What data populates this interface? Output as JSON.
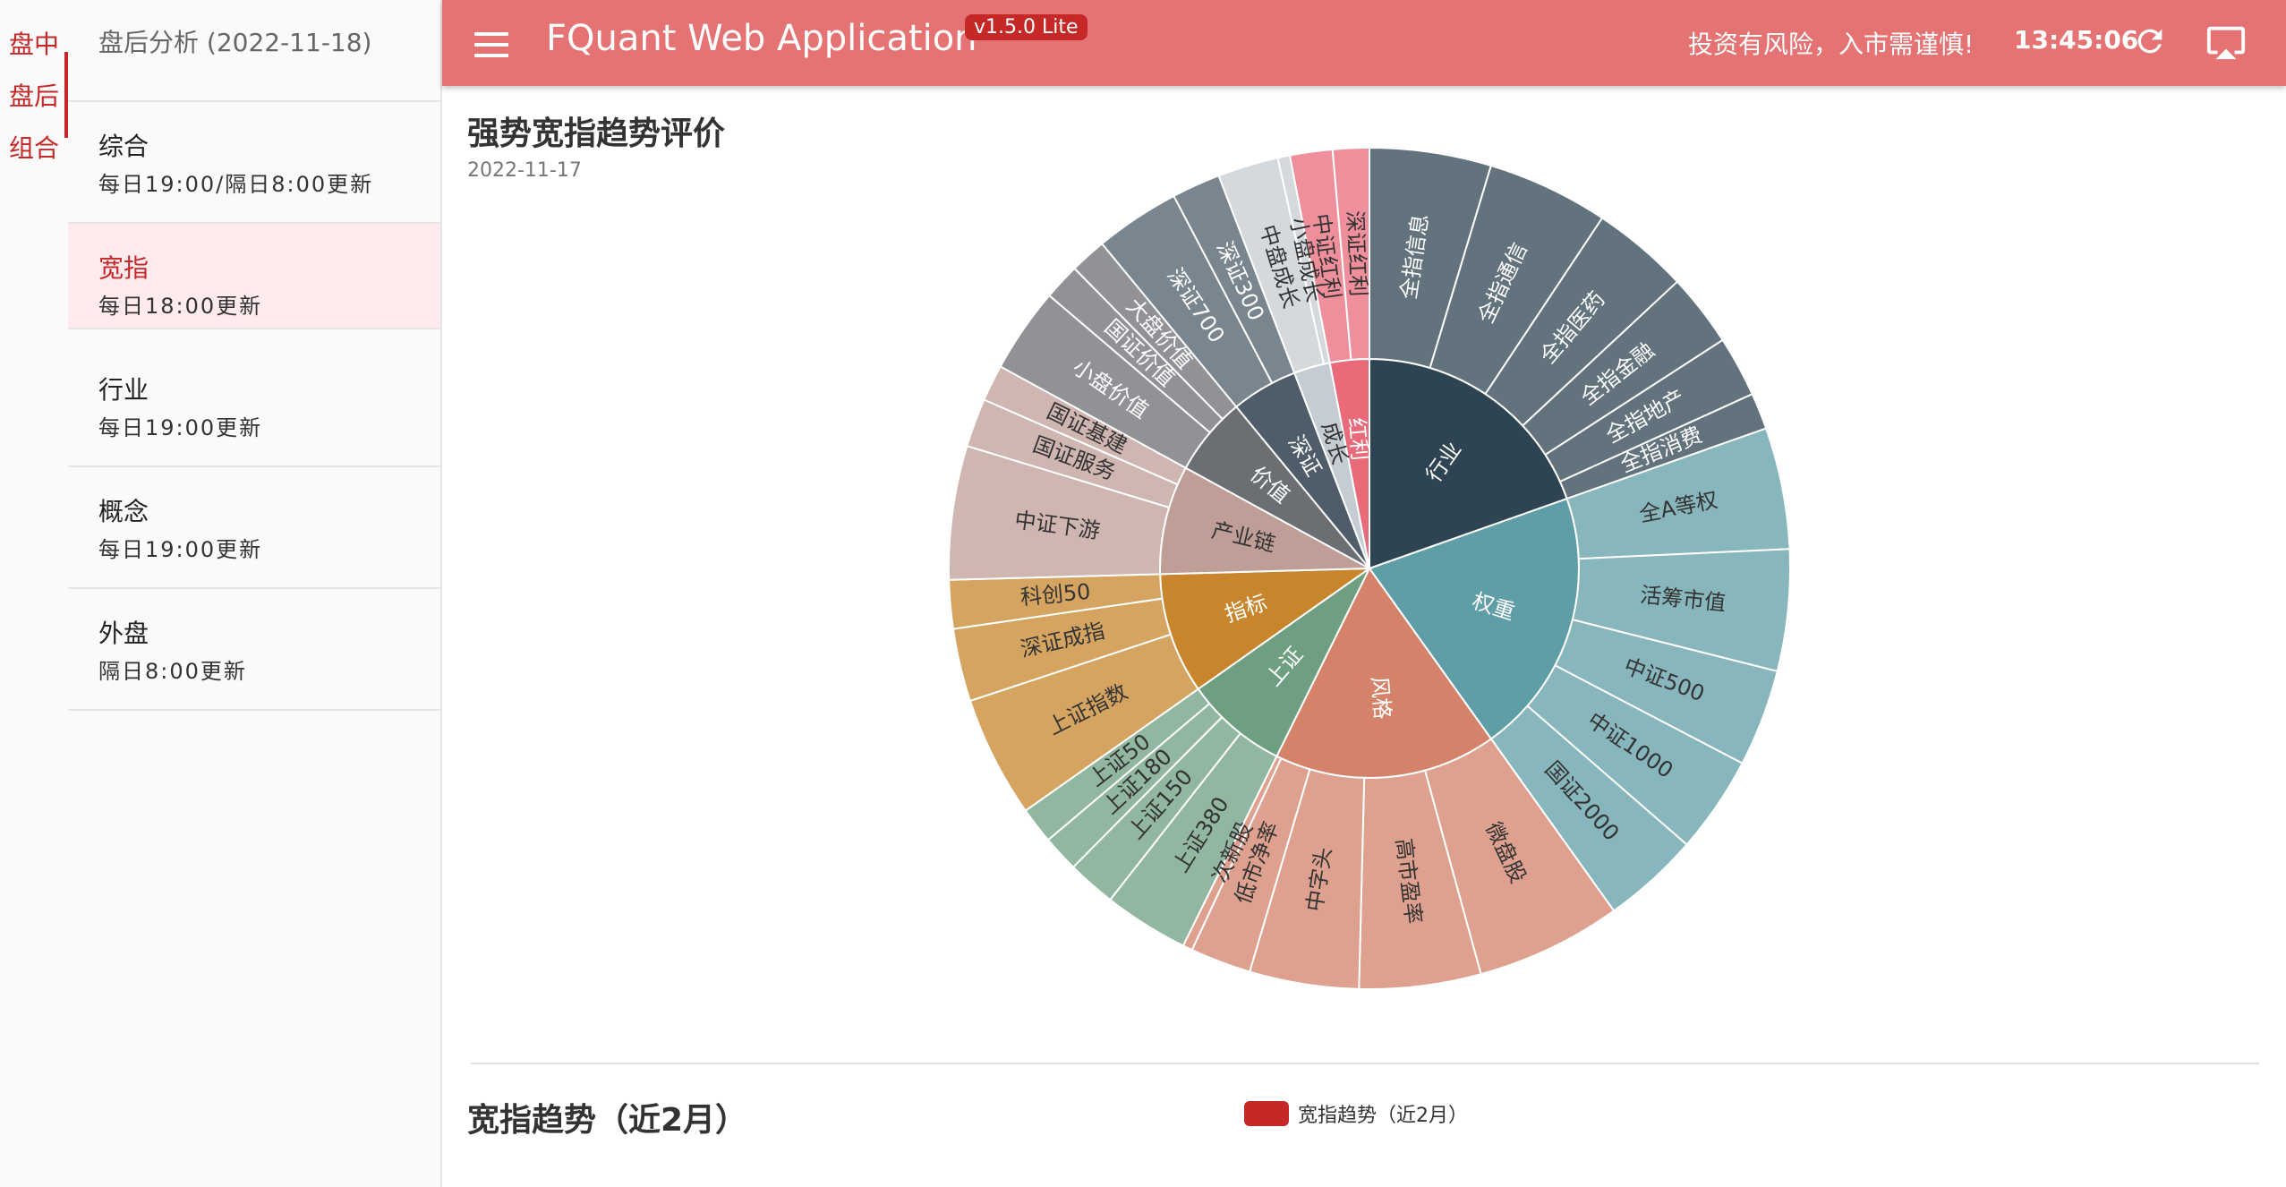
{
  "rail": {
    "items": [
      "盘中",
      "盘后",
      "组合"
    ]
  },
  "sidebar": {
    "title": "盘后分析 (2022-11-18)",
    "items": [
      {
        "name": "综合",
        "sub": "每日19:00/隔日8:00更新"
      },
      {
        "name": "宽指",
        "sub": "每日18:00更新"
      },
      {
        "name": "行业",
        "sub": "每日19:00更新"
      },
      {
        "name": "概念",
        "sub": "每日19:00更新"
      },
      {
        "name": "外盘",
        "sub": "隔日8:00更新"
      }
    ]
  },
  "header": {
    "title": "FQuant Web Application",
    "version": "v1.5.0 Lite",
    "warning": "投资有风险，入市需谨慎!",
    "time": "13:45:06"
  },
  "main": {
    "title": "强势宽指趋势评价",
    "date": "2022-11-17",
    "title2": "宽指趋势（近2月）",
    "legend": "宽指趋势（近2月）"
  },
  "chart_data": {
    "type": "sunburst",
    "title": "强势宽指趋势评价",
    "levels": [
      {
        "name": "行业",
        "color": "#2e4453",
        "children": [
          {
            "name": "全指信息",
            "value": 10
          },
          {
            "name": "全指通信",
            "value": 10
          },
          {
            "name": "全指医药",
            "value": 8
          },
          {
            "name": "全指金融",
            "value": 6
          },
          {
            "name": "全指地产",
            "value": 5
          },
          {
            "name": "全指消费",
            "value": 3
          }
        ]
      },
      {
        "name": "权重",
        "color": "#5f9ea6",
        "children": [
          {
            "name": "全A等权",
            "value": 10
          },
          {
            "name": "活筹市值",
            "value": 10
          },
          {
            "name": "中证500",
            "value": 8
          },
          {
            "name": "中证1000",
            "value": 8
          },
          {
            "name": "国证2000",
            "value": 8
          }
        ]
      },
      {
        "name": "风格",
        "color": "#d4826a",
        "children": [
          {
            "name": "微盘股",
            "value": 12
          },
          {
            "name": "高市盈率",
            "value": 10
          },
          {
            "name": "中字头",
            "value": 9
          },
          {
            "name": "低市净率",
            "value": 5
          },
          {
            "name": "次新股",
            "value": 0.8
          }
        ]
      },
      {
        "name": "上证",
        "color": "#6e9f80",
        "children": [
          {
            "name": "上证380",
            "value": 7
          },
          {
            "name": "上证150",
            "value": 4
          },
          {
            "name": "上证180",
            "value": 3
          },
          {
            "name": "上证50",
            "value": 3
          }
        ]
      },
      {
        "name": "指标",
        "color": "#c8852c",
        "children": [
          {
            "name": "上证指数",
            "value": 10
          },
          {
            "name": "深证成指",
            "value": 6
          },
          {
            "name": "科创50",
            "value": 4
          }
        ]
      },
      {
        "name": "产业链",
        "color": "#bf9e97",
        "children": [
          {
            "name": "中证下游",
            "value": 11
          },
          {
            "name": "国证服务",
            "value": 4
          },
          {
            "name": "国证基建",
            "value": 3
          }
        ]
      },
      {
        "name": "价值",
        "color": "#6b6e73",
        "children": [
          {
            "name": "小盘价值",
            "value": 7
          },
          {
            "name": "国证价值",
            "value": 3
          },
          {
            "name": "大盘价值",
            "value": 3
          }
        ]
      },
      {
        "name": "深证",
        "color": "#4e5d69",
        "children": [
          {
            "name": "深证700",
            "value": 7
          },
          {
            "name": "深证300",
            "value": 4
          }
        ]
      },
      {
        "name": "成长",
        "color": "#c5ccd3",
        "children": [
          {
            "name": "中盘成长",
            "value": 5
          },
          {
            "name": "小盘成长",
            "value": 1
          }
        ]
      },
      {
        "name": "红利",
        "color": "#e96a79",
        "children": [
          {
            "name": "中证红利",
            "value": 3.5
          },
          {
            "name": "深证红利",
            "value": 3
          }
        ]
      }
    ]
  }
}
